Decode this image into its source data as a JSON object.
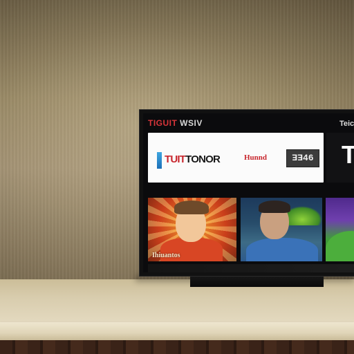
{
  "tv_screen": {
    "top_label_left": "TIGUIT",
    "top_label_left_rest": "WSIV",
    "top_label_right": "Teicha",
    "hero": {
      "title_part1": "TUIT",
      "title_part2": "TONOR",
      "subtitle": "Hunnd",
      "badge": "ƎƎ46"
    },
    "side_tile_letter": "T",
    "thumbnails": [
      {
        "caption": "Ihiuantos"
      },
      {
        "caption": ""
      },
      {
        "caption": ""
      }
    ]
  },
  "colors": {
    "wall": "#a8977a",
    "shelf": "#e4dac0",
    "accent_red": "#c8262d",
    "accent_blue": "#3fa6e0"
  }
}
